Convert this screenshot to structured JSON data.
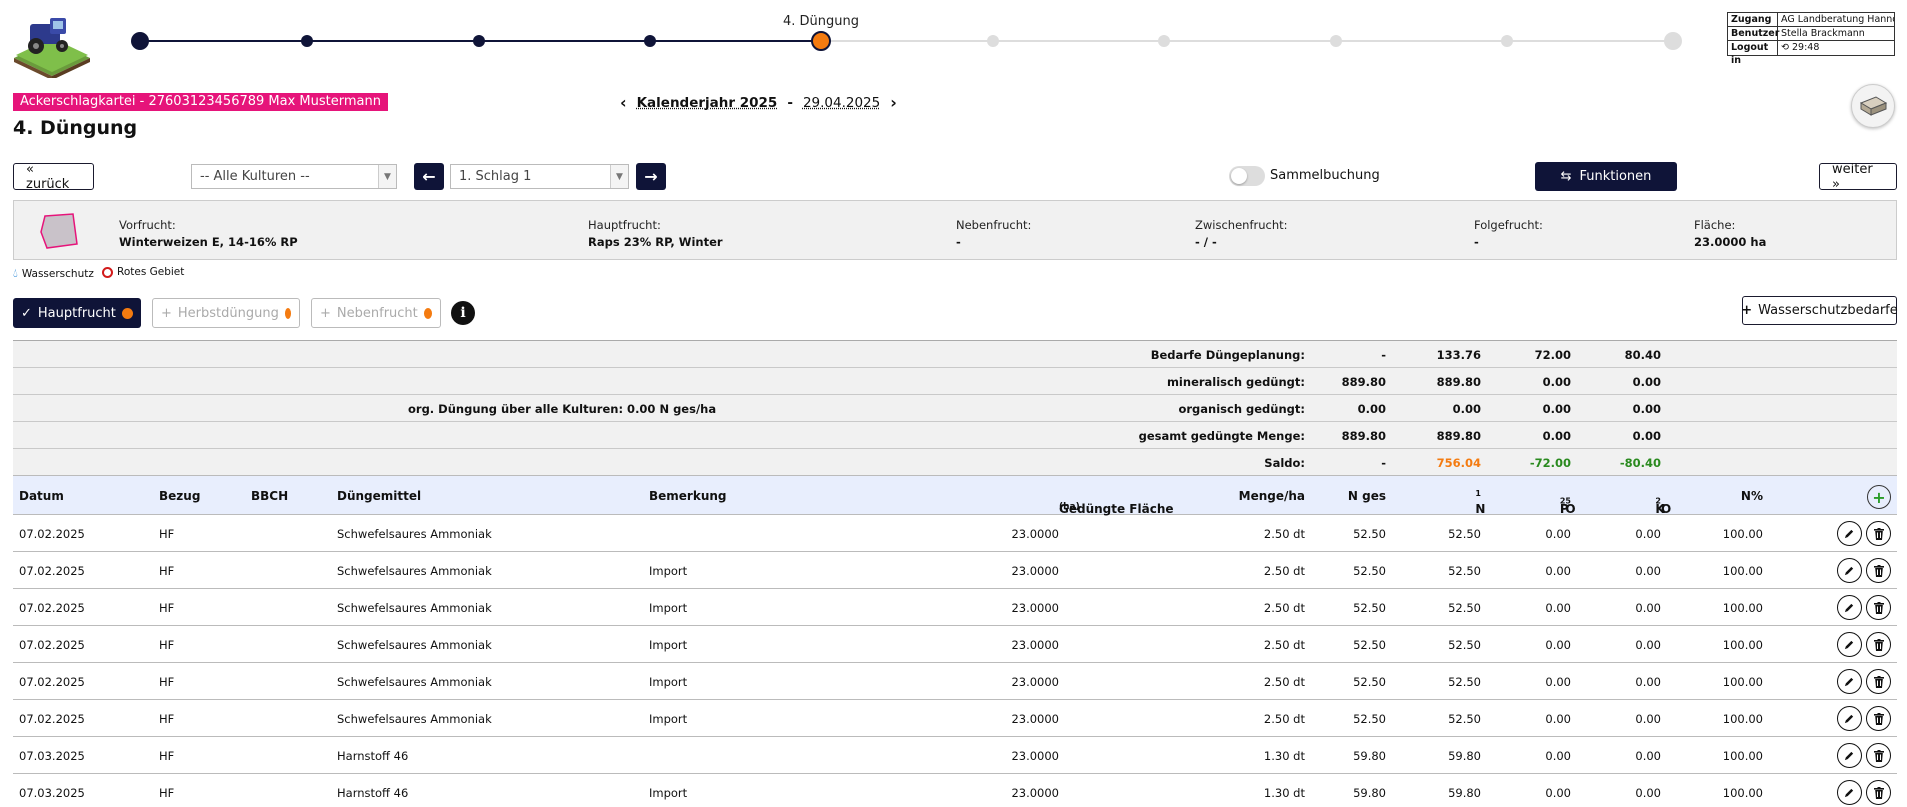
{
  "stepper": {
    "current_label": "4. Düngung",
    "steps_total": 10,
    "current_index": 4,
    "colors": {
      "done": "#0f1438",
      "current": "#f47b10",
      "pending": "#cccccc"
    }
  },
  "user": {
    "rows": [
      {
        "key": "Zugang",
        "value": "AG Landberatung Hannover"
      },
      {
        "key": "Benutzer",
        "value": "Stella Brackmann"
      },
      {
        "key": "Logout in",
        "value": "29:48"
      }
    ]
  },
  "header": {
    "record": "Ackerschlagkartei - 27603123456789 Max Mustermann",
    "title": "4. Düngung",
    "year_label": "Kalenderjahr 2025",
    "separator": "-",
    "date": "29.04.2025"
  },
  "toolbar": {
    "back": "«  zurück",
    "culture_select": "-- Alle Kulturen --",
    "field_select": "1. Schlag 1",
    "sammel_label": "Sammelbuchung",
    "funktionen": "Funktionen",
    "next": "weiter  »"
  },
  "field_info": {
    "vorfrucht_label": "Vorfrucht:",
    "vorfrucht": "Winterweizen E, 14-16% RP",
    "hauptfrucht_label": "Hauptfrucht:",
    "hauptfrucht": "Raps 23% RP, Winter",
    "nebenfrucht_label": "Nebenfrucht:",
    "nebenfrucht": "-",
    "zwischenfrucht_label": "Zwischenfrucht:",
    "zwischenfrucht": "- / -",
    "folgefrucht_label": "Folgefrucht:",
    "folgefrucht": "-",
    "flaeche_label": "Fläche:",
    "flaeche": "23.0000 ha"
  },
  "legend": {
    "wasserschutz": "Wasserschutz",
    "rotes_gebiet": "Rotes Gebiet"
  },
  "tabs": {
    "hauptfrucht": "Hauptfrucht",
    "herbst": "Herbstdüngung",
    "neben": "Nebenfrucht",
    "info": "i",
    "wasserschutz_btn": "Wasserschutzbedarfe"
  },
  "summary": {
    "org_note": "org. Düngung über alle Kulturen: 0.00 N ges/ha",
    "rows": [
      {
        "label": "Bedarfe Düngeplanung:",
        "v": [
          "-",
          "133.76",
          "72.00",
          "80.40"
        ]
      },
      {
        "label": "mineralisch gedüngt:",
        "v": [
          "889.80",
          "889.80",
          "0.00",
          "0.00"
        ]
      },
      {
        "label": "organisch gedüngt:",
        "v": [
          "0.00",
          "0.00",
          "0.00",
          "0.00"
        ]
      },
      {
        "label": "gesamt gedüngte Menge:",
        "v": [
          "889.80",
          "889.80",
          "0.00",
          "0.00"
        ]
      },
      {
        "label": "Saldo:",
        "v": [
          "-",
          "756.04",
          "-72.00",
          "-80.40"
        ]
      }
    ]
  },
  "table": {
    "headers": {
      "datum": "Datum",
      "bezug": "Bezug",
      "bbch": "BBCH",
      "duengemittel": "Düngemittel",
      "bemerkung": "Bemerkung",
      "flaeche": "Gedüngte Fläche",
      "flaeche_unit": "(ha)",
      "menge": "Menge/ha",
      "nges": "N ges",
      "n": "N",
      "n_sup": "1",
      "p": "P",
      "p_sub1": "2",
      "p_o": "O",
      "p_sub2": "5",
      "k": "K",
      "k_sub": "2",
      "k_o": "O",
      "npct": "N%"
    },
    "rows": [
      {
        "datum": "07.02.2025",
        "bezug": "HF",
        "bbch": "",
        "mittel": "Schwefelsaures Ammoniak",
        "bem": "",
        "fl": "23.0000",
        "menge": "2.50 dt",
        "nges": "52.50",
        "n": "52.50",
        "p": "0.00",
        "k": "0.00",
        "npct": "100.00"
      },
      {
        "datum": "07.02.2025",
        "bezug": "HF",
        "bbch": "",
        "mittel": "Schwefelsaures Ammoniak",
        "bem": "Import",
        "fl": "23.0000",
        "menge": "2.50 dt",
        "nges": "52.50",
        "n": "52.50",
        "p": "0.00",
        "k": "0.00",
        "npct": "100.00"
      },
      {
        "datum": "07.02.2025",
        "bezug": "HF",
        "bbch": "",
        "mittel": "Schwefelsaures Ammoniak",
        "bem": "Import",
        "fl": "23.0000",
        "menge": "2.50 dt",
        "nges": "52.50",
        "n": "52.50",
        "p": "0.00",
        "k": "0.00",
        "npct": "100.00"
      },
      {
        "datum": "07.02.2025",
        "bezug": "HF",
        "bbch": "",
        "mittel": "Schwefelsaures Ammoniak",
        "bem": "Import",
        "fl": "23.0000",
        "menge": "2.50 dt",
        "nges": "52.50",
        "n": "52.50",
        "p": "0.00",
        "k": "0.00",
        "npct": "100.00"
      },
      {
        "datum": "07.02.2025",
        "bezug": "HF",
        "bbch": "",
        "mittel": "Schwefelsaures Ammoniak",
        "bem": "Import",
        "fl": "23.0000",
        "menge": "2.50 dt",
        "nges": "52.50",
        "n": "52.50",
        "p": "0.00",
        "k": "0.00",
        "npct": "100.00"
      },
      {
        "datum": "07.02.2025",
        "bezug": "HF",
        "bbch": "",
        "mittel": "Schwefelsaures Ammoniak",
        "bem": "Import",
        "fl": "23.0000",
        "menge": "2.50 dt",
        "nges": "52.50",
        "n": "52.50",
        "p": "0.00",
        "k": "0.00",
        "npct": "100.00"
      },
      {
        "datum": "07.03.2025",
        "bezug": "HF",
        "bbch": "",
        "mittel": "Harnstoff 46",
        "bem": "",
        "fl": "23.0000",
        "menge": "1.30 dt",
        "nges": "59.80",
        "n": "59.80",
        "p": "0.00",
        "k": "0.00",
        "npct": "100.00"
      },
      {
        "datum": "07.03.2025",
        "bezug": "HF",
        "bbch": "",
        "mittel": "Harnstoff 46",
        "bem": "Import",
        "fl": "23.0000",
        "menge": "1.30 dt",
        "nges": "59.80",
        "n": "59.80",
        "p": "0.00",
        "k": "0.00",
        "npct": "100.00"
      }
    ]
  }
}
